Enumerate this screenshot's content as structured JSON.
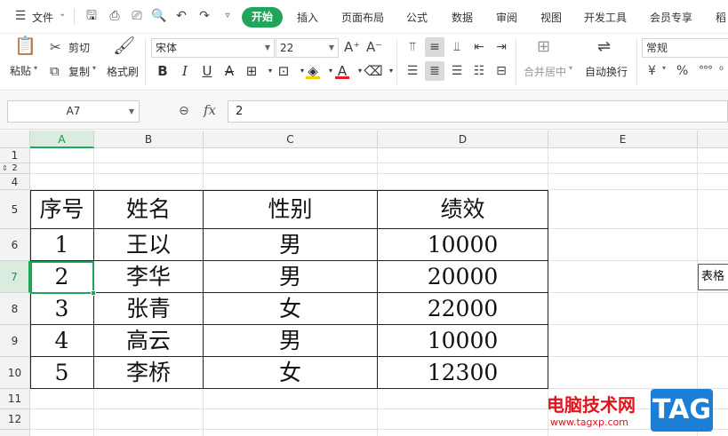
{
  "menubar": {
    "file_label": "文件",
    "tabs": [
      "开始",
      "插入",
      "页面布局",
      "公式",
      "数据",
      "审阅",
      "视图",
      "开发工具",
      "会员专享",
      "稻"
    ]
  },
  "ribbon": {
    "paste": "粘贴",
    "cut": "剪切",
    "copy": "复制",
    "format_painter": "格式刷",
    "font_name": "宋体",
    "font_size": "22",
    "merge_center": "合并居中",
    "wrap_text": "自动换行",
    "number_format": "常规",
    "colors": {
      "font_color": "#e02020",
      "fill_color": "#f5d000",
      "accent": "#22a55b"
    }
  },
  "formula_bar": {
    "cell_ref": "A7",
    "fx": "fx",
    "value": "2"
  },
  "sheet": {
    "columns": [
      "A",
      "B",
      "C",
      "D",
      "E"
    ],
    "selected_column": "A",
    "rows": [
      "1",
      "2",
      "4",
      "5",
      "6",
      "7",
      "8",
      "9",
      "10",
      "11",
      "12"
    ],
    "selected_row": "7",
    "table": {
      "headers": [
        "序号",
        "姓名",
        "性别",
        "绩效"
      ],
      "rows": [
        [
          "1",
          "王以",
          "男",
          "10000"
        ],
        [
          "2",
          "李华",
          "男",
          "20000"
        ],
        [
          "3",
          "张青",
          "女",
          "22000"
        ],
        [
          "4",
          "高云",
          "男",
          "10000"
        ],
        [
          "5",
          "李桥",
          "女",
          "12300"
        ]
      ]
    },
    "tooltip_text": "表格"
  },
  "watermark": {
    "site_name": "电脑技术网",
    "url": "www.tagxp.com",
    "tag": "TAG"
  }
}
